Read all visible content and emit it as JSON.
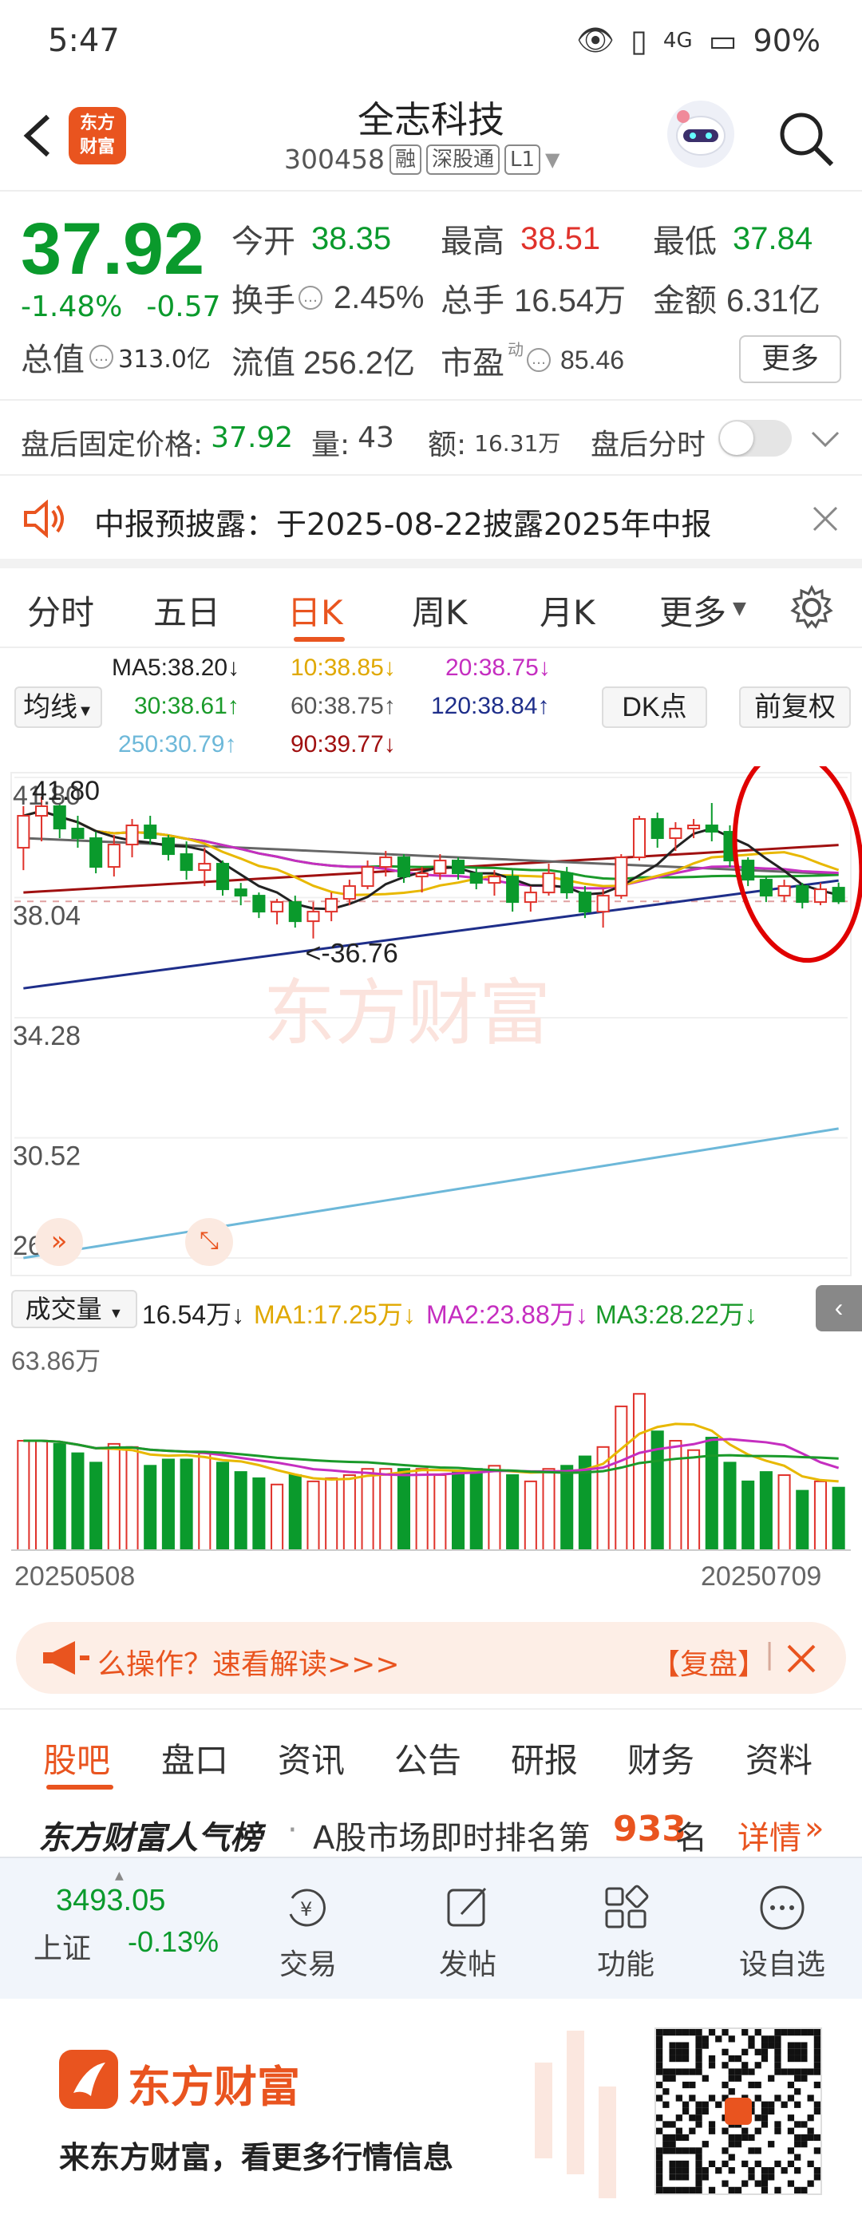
{
  "status_bar": {
    "time": "5:47",
    "battery": "90%",
    "net": "4G"
  },
  "header": {
    "logo_text_1": "东方",
    "logo_text_2": "财富",
    "stock_name": "全志科技",
    "code": "300458",
    "tags": [
      "融",
      "深股通",
      "L1"
    ]
  },
  "quote": {
    "price": "37.92",
    "change_pct": "-1.48%",
    "change": "-0.57",
    "open_label": "今开",
    "open": "38.35",
    "high_label": "最高",
    "high": "38.51",
    "low_label": "最低",
    "low": "37.84",
    "turnover_label": "换手",
    "turnover": "2.45%",
    "volume_label": "总手",
    "volume": "16.54万",
    "amount_label": "金额",
    "amount": "6.31亿",
    "mcap_label": "总值",
    "mcap": "313.0亿",
    "float_label": "流值",
    "float": "256.2亿",
    "pe_label": "市盈",
    "pe_sup": "动",
    "pe": "85.46",
    "more": "更多"
  },
  "after_hours": {
    "price_label": "盘后固定价格:",
    "price": "37.92",
    "vol_label": "量:",
    "vol": "43",
    "amt_label": "额:",
    "amt": "16.31万",
    "timeshare_label": "盘后分时"
  },
  "notice": {
    "text": "中报预披露：于2025-08-22披露2025年中报"
  },
  "period_tabs": [
    "分时",
    "五日",
    "日K",
    "周K",
    "月K",
    "更多"
  ],
  "active_tab": "日K",
  "ma_legend": {
    "ma5": "MA5:38.20↓",
    "ma10": "10:38.85↓",
    "ma20": "20:38.75↓",
    "ma30": "30:38.61↑",
    "ma60": "60:38.75↑",
    "ma120": "120:38.84↑",
    "ma250": "250:30.79↑",
    "ma90": "90:39.77↓",
    "ma_select": "均线",
    "dk": "DK点",
    "fq": "前复权"
  },
  "colors": {
    "up": "#e0322b",
    "down": "#0a9a2c",
    "brand": "#e9541f",
    "ma5": "#222222",
    "ma10": "#e8b800",
    "ma20": "#c52ec0",
    "ma30": "#1a9a2a",
    "ma60": "#666666",
    "ma120": "#1e2e8a",
    "ma250": "#6db8d9",
    "ma90": "#a01010"
  },
  "chart_data": {
    "type": "candlestick",
    "y_ticks": [
      "41.80",
      "38.04",
      "34.28",
      "30.52",
      "26.76"
    ],
    "ylim": [
      26.76,
      41.8
    ],
    "high_marker": "41.80",
    "low_marker": "<-36.76",
    "candles": [
      [
        39.6,
        40.9,
        38.9,
        40.6
      ],
      [
        40.6,
        41.2,
        39.8,
        40.9
      ],
      [
        40.9,
        41.0,
        39.9,
        40.2
      ],
      [
        40.2,
        40.6,
        39.6,
        39.9
      ],
      [
        39.9,
        40.1,
        38.8,
        39.0
      ],
      [
        39.0,
        40.0,
        38.7,
        39.7
      ],
      [
        39.7,
        40.5,
        39.3,
        40.3
      ],
      [
        40.3,
        40.6,
        39.7,
        39.9
      ],
      [
        39.9,
        40.0,
        39.2,
        39.4
      ],
      [
        39.4,
        39.8,
        38.6,
        38.9
      ],
      [
        38.9,
        39.6,
        38.4,
        39.1
      ],
      [
        39.1,
        39.2,
        38.1,
        38.3
      ],
      [
        38.3,
        38.5,
        37.8,
        38.1
      ],
      [
        38.1,
        38.2,
        37.4,
        37.6
      ],
      [
        37.6,
        38.0,
        37.2,
        37.9
      ],
      [
        37.9,
        38.1,
        37.1,
        37.3
      ],
      [
        37.3,
        37.9,
        36.76,
        37.6
      ],
      [
        37.6,
        38.2,
        37.3,
        38.0
      ],
      [
        38.0,
        38.6,
        37.8,
        38.4
      ],
      [
        38.4,
        39.2,
        38.3,
        39.0
      ],
      [
        39.0,
        39.5,
        38.7,
        39.3
      ],
      [
        39.3,
        39.4,
        38.5,
        38.7
      ],
      [
        38.7,
        39.0,
        38.2,
        38.8
      ],
      [
        38.8,
        39.4,
        38.6,
        39.2
      ],
      [
        39.2,
        39.3,
        38.6,
        38.8
      ],
      [
        38.8,
        39.0,
        38.3,
        38.5
      ],
      [
        38.5,
        38.9,
        38.1,
        38.7
      ],
      [
        38.7,
        38.9,
        37.6,
        37.9
      ],
      [
        37.9,
        38.4,
        37.6,
        38.2
      ],
      [
        38.2,
        39.1,
        38.1,
        38.8
      ],
      [
        38.8,
        39.0,
        38.0,
        38.2
      ],
      [
        38.2,
        38.4,
        37.4,
        37.6
      ],
      [
        37.6,
        38.3,
        37.1,
        38.1
      ],
      [
        38.1,
        39.4,
        38.0,
        39.3
      ],
      [
        39.3,
        40.6,
        39.2,
        40.5
      ],
      [
        40.5,
        40.7,
        39.6,
        39.9
      ],
      [
        39.9,
        40.4,
        39.5,
        40.2
      ],
      [
        40.2,
        40.5,
        39.9,
        40.3
      ],
      [
        40.3,
        41.0,
        39.8,
        40.1
      ],
      [
        40.1,
        40.3,
        39.0,
        39.2
      ],
      [
        39.2,
        39.3,
        38.4,
        38.6
      ],
      [
        38.6,
        38.7,
        37.9,
        38.1
      ],
      [
        38.1,
        38.6,
        37.9,
        38.4
      ],
      [
        38.4,
        38.5,
        37.7,
        37.9
      ],
      [
        37.9,
        38.5,
        37.8,
        38.3
      ],
      [
        38.35,
        38.51,
        37.84,
        37.92
      ]
    ],
    "volume": {
      "label": "成交量",
      "value": "16.54万↓",
      "ma1": "MA1:17.25万↓",
      "ma2": "MA2:23.88万↓",
      "ma3": "MA3:28.22万↓",
      "max_label": "63.86万",
      "values": [
        35,
        35,
        34,
        31,
        28,
        34,
        33,
        27,
        29,
        29,
        31,
        28,
        25,
        23,
        21,
        24,
        22,
        23,
        24,
        26,
        26,
        26,
        26,
        24,
        25,
        26,
        27,
        24,
        22,
        26,
        27,
        30,
        33,
        46,
        50,
        38,
        35,
        32,
        36,
        28,
        22,
        25,
        24,
        19,
        22,
        20
      ]
    },
    "start_date": "20250508",
    "end_date": "20250709"
  },
  "banner": {
    "text": "么操作？速看解读>>>",
    "action": "【复盘】"
  },
  "sub_tabs": [
    "股吧",
    "盘口",
    "资讯",
    "公告",
    "研报",
    "财务",
    "资料"
  ],
  "rank": {
    "title": "东方财富人气榜",
    "text": "A股市场即时排名第",
    "num": "933",
    "suffix": "名",
    "detail": "详情"
  },
  "index": {
    "value": "3493.05",
    "name": "上证",
    "chg": "-0.13%"
  },
  "bottom_nav": [
    "交易",
    "发帖",
    "功能",
    "设自选"
  ],
  "promo": {
    "brand": "东方财富",
    "slogan": "来东方财富，看更多行情信息"
  }
}
